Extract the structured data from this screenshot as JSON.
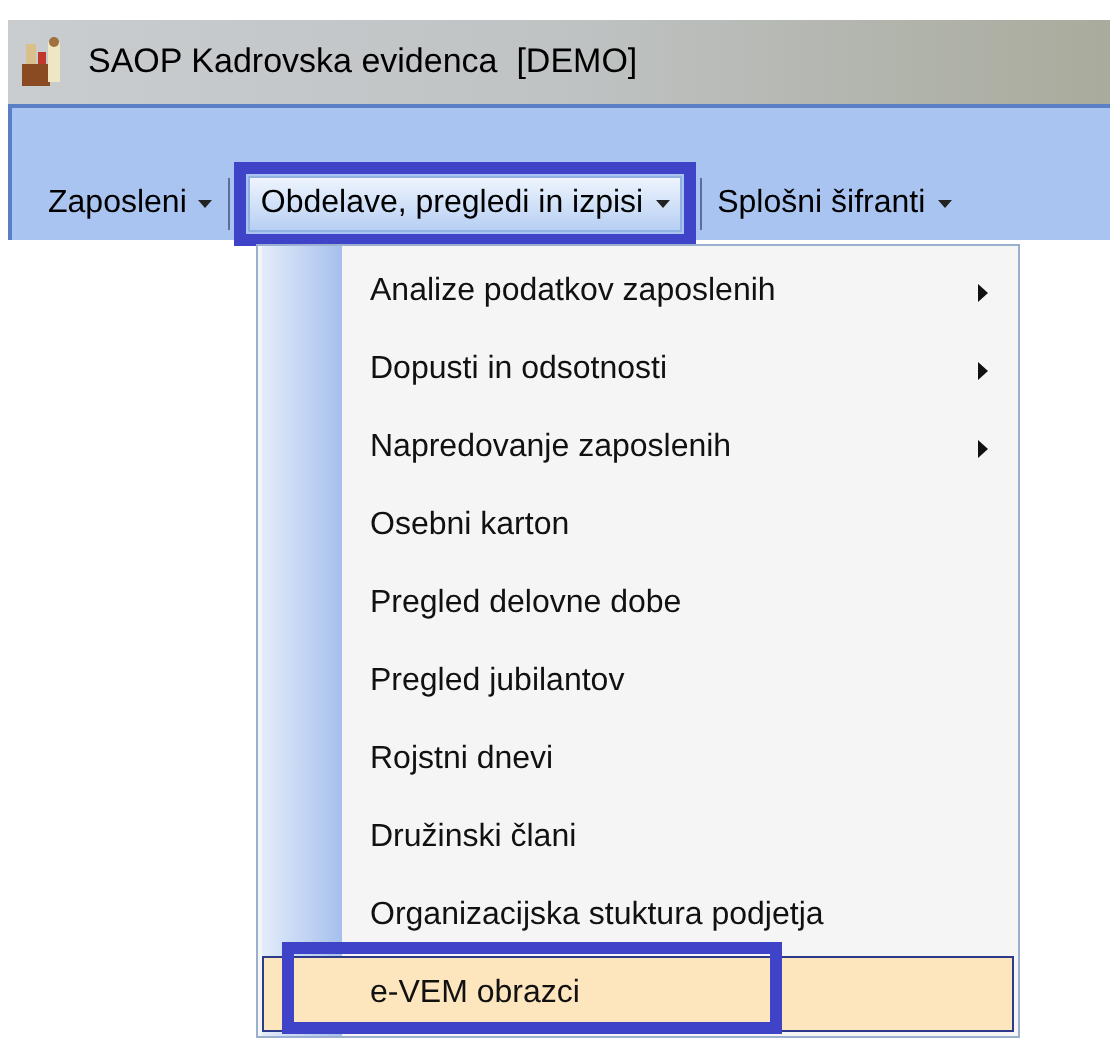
{
  "window": {
    "title": "SAOP Kadrovska evidenca  [DEMO]"
  },
  "menu_bar": [
    {
      "label": "Zaposleni",
      "selected": false,
      "outlined": false
    },
    {
      "label": "Obdelave, pregledi in izpisi",
      "selected": true,
      "outlined": true
    },
    {
      "label": "Splošni šifranti",
      "selected": false,
      "outlined": false
    }
  ],
  "menu": {
    "items": [
      {
        "label": "Analize podatkov zaposlenih",
        "submenu": true,
        "selected": false,
        "outlined": false
      },
      {
        "label": "Dopusti in odsotnosti",
        "submenu": true,
        "selected": false,
        "outlined": false
      },
      {
        "label": "Napredovanje zaposlenih",
        "submenu": true,
        "selected": false,
        "outlined": false
      },
      {
        "label": "Osebni karton",
        "submenu": false,
        "selected": false,
        "outlined": false
      },
      {
        "label": "Pregled delovne dobe",
        "submenu": false,
        "selected": false,
        "outlined": false
      },
      {
        "label": "Pregled jubilantov",
        "submenu": false,
        "selected": false,
        "outlined": false
      },
      {
        "label": "Rojstni dnevi",
        "submenu": false,
        "selected": false,
        "outlined": false
      },
      {
        "label": "Družinski člani",
        "submenu": false,
        "selected": false,
        "outlined": false
      },
      {
        "label": "Organizacijska stuktura podjetja",
        "submenu": false,
        "selected": false,
        "outlined": false
      },
      {
        "label": "e-VEM obrazci",
        "submenu": false,
        "selected": true,
        "outlined": true
      }
    ]
  }
}
